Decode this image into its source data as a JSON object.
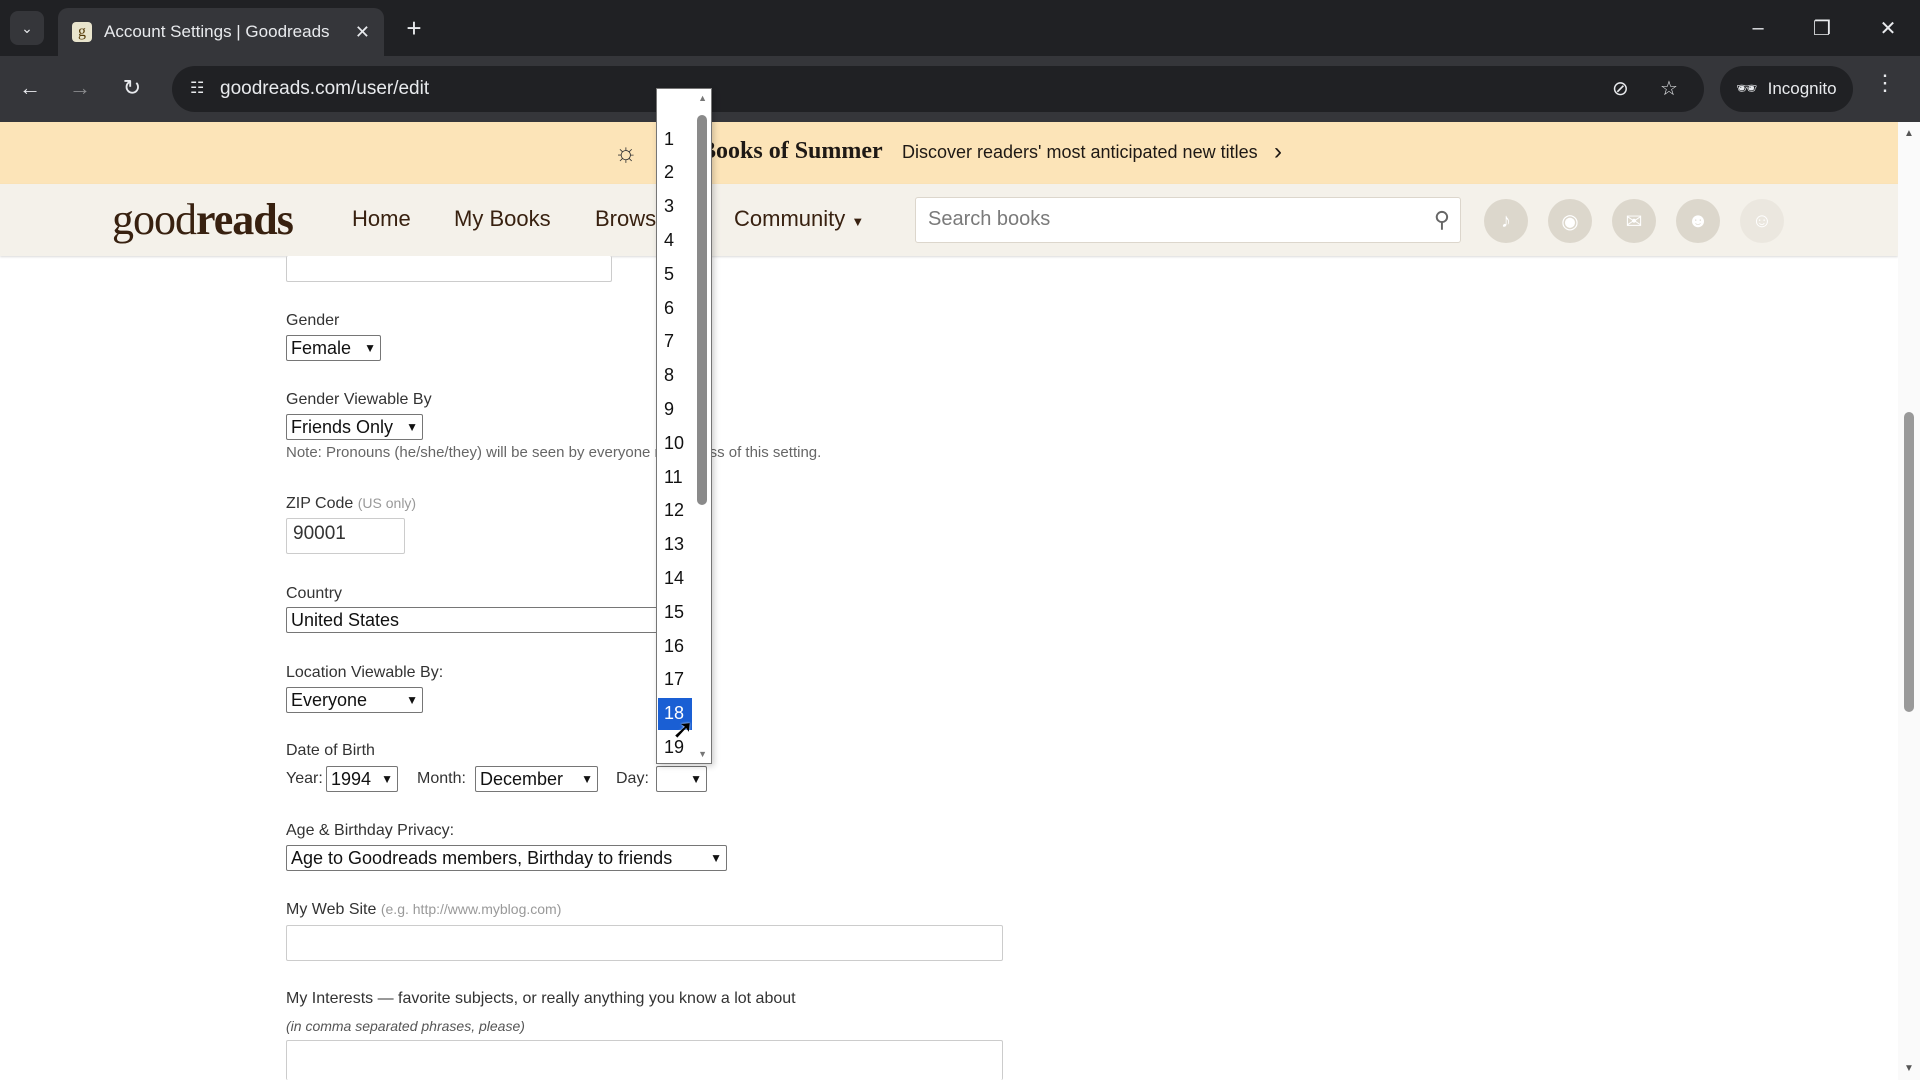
{
  "browser": {
    "tab_title": "Account Settings | Goodreads",
    "favicon_letter": "g",
    "url": "goodreads.com/user/edit",
    "incognito_label": "Incognito"
  },
  "promo": {
    "title": "Books of Summer",
    "text": "Discover readers' most anticipated new titles"
  },
  "header": {
    "logo_light": "good",
    "logo_bold": "reads",
    "nav": [
      "Home",
      "My Books",
      "Browse",
      "Community"
    ],
    "search_placeholder": "Search books"
  },
  "form": {
    "gender_label": "Gender",
    "gender_value": "Female",
    "gender_viewable_label": "Gender Viewable By",
    "gender_viewable_value": "Friends Only",
    "pronoun_note": "Note: Pronouns (he/she/they) will be seen by everyone regardless of this setting.",
    "zip_label": "ZIP Code",
    "zip_hint": "(US only)",
    "zip_value": "90001",
    "country_label": "Country",
    "country_value": "United States",
    "location_viewable_label": "Location Viewable By:",
    "location_viewable_value": "Everyone",
    "dob_label": "Date of Birth",
    "year_label": "Year:",
    "year_value": "1994",
    "month_label": "Month:",
    "month_value": "December",
    "day_label": "Day:",
    "day_value": "",
    "privacy_label": "Age & Birthday Privacy:",
    "privacy_value": "Age to Goodreads members, Birthday to friends",
    "website_label": "My Web Site",
    "website_hint": "(e.g. http://www.myblog.com)",
    "website_value": "",
    "interests_label": "My Interests — favorite subjects, or really anything you know a lot about",
    "interests_hint": "(in comma separated phrases, please)"
  },
  "day_dropdown": {
    "options": [
      "1",
      "2",
      "3",
      "4",
      "5",
      "6",
      "7",
      "8",
      "9",
      "10",
      "11",
      "12",
      "13",
      "14",
      "15",
      "16",
      "17",
      "18",
      "19"
    ],
    "highlighted": "18"
  }
}
